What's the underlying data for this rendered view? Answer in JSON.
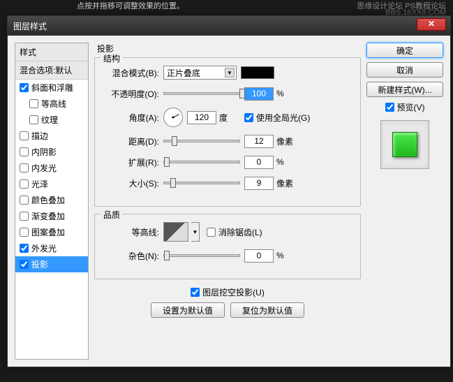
{
  "hint": "点按并拖移可调整效果的位置。",
  "watermark1": "思缘设计论坛   PS教程论坛",
  "watermark2": "BBS.16XX8.COM",
  "title": "图层样式",
  "close": "✕",
  "styles": {
    "header1": "样式",
    "header2": "混合选项:默认",
    "items": [
      {
        "label": "斜面和浮雕",
        "checked": true,
        "sub": false
      },
      {
        "label": "等高线",
        "checked": false,
        "sub": true
      },
      {
        "label": "纹理",
        "checked": false,
        "sub": true
      },
      {
        "label": "描边",
        "checked": false,
        "sub": false
      },
      {
        "label": "内阴影",
        "checked": false,
        "sub": false
      },
      {
        "label": "内发光",
        "checked": false,
        "sub": false
      },
      {
        "label": "光泽",
        "checked": false,
        "sub": false
      },
      {
        "label": "颜色叠加",
        "checked": false,
        "sub": false
      },
      {
        "label": "渐变叠加",
        "checked": false,
        "sub": false
      },
      {
        "label": "图案叠加",
        "checked": false,
        "sub": false
      },
      {
        "label": "外发光",
        "checked": true,
        "sub": false
      },
      {
        "label": "投影",
        "checked": true,
        "sub": false,
        "selected": true
      }
    ]
  },
  "panel": {
    "title": "投影",
    "structure": {
      "group": "结构",
      "blend_mode_label": "混合模式(B):",
      "blend_mode_value": "正片叠底",
      "opacity_label": "不透明度(O):",
      "opacity_value": "100",
      "opacity_unit": "%",
      "angle_label": "角度(A):",
      "angle_value": "120",
      "angle_unit": "度",
      "global_light": "使用全局光(G)",
      "distance_label": "距离(D):",
      "distance_value": "12",
      "distance_unit": "像素",
      "spread_label": "扩展(R):",
      "spread_value": "0",
      "spread_unit": "%",
      "size_label": "大小(S):",
      "size_value": "9",
      "size_unit": "像素"
    },
    "quality": {
      "group": "品质",
      "contour_label": "等高线:",
      "antialias": "消除锯齿(L)",
      "noise_label": "杂色(N):",
      "noise_value": "0",
      "noise_unit": "%"
    },
    "knockout": "图层挖空投影(U)",
    "set_default": "设置为默认值",
    "reset_default": "复位为默认值"
  },
  "right": {
    "ok": "确定",
    "cancel": "取消",
    "new_style": "新建样式(W)...",
    "preview": "预览(V)"
  }
}
